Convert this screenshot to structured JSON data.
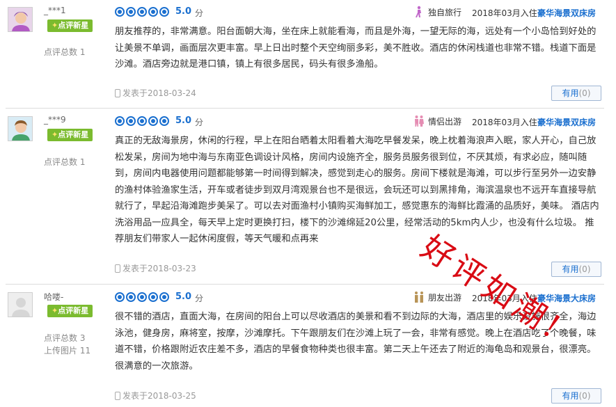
{
  "reviews": [
    {
      "username": "_***1",
      "badge": "点评新星",
      "review_count": "点评总数 1",
      "photo_count": "",
      "score": "5.0",
      "score_unit": "分",
      "trip_type": "独自旅行",
      "stay_date": "2018年03月入住",
      "room_type": "豪华海景双床房",
      "text": "朋友推荐的，非常满意。阳台面朝大海，坐在床上就能看海，而且是外海，一望无际的海，远处有一个小岛恰到好处的让美景不单调，画面层次更丰富。早上日出时整个天空绚丽多彩，美不胜收。酒店的休闲栈道也非常不错。栈道下面是沙滩。酒店旁边就是港口镇，镇上有很多居民，码头有很多渔船。",
      "posted": "发表于2018-03-24",
      "useful_label": "有用",
      "useful_count": "(0)",
      "avatar_icon": "avatar-purple-icon",
      "trip_icon": "solo-travel-icon"
    },
    {
      "username": "_***9",
      "badge": "点评新星",
      "review_count": "点评总数 1",
      "photo_count": "",
      "score": "5.0",
      "score_unit": "分",
      "trip_type": "情侣出游",
      "stay_date": "2018年03月入住",
      "room_type": "豪华海景双床房",
      "text": "真正的无敌海景房，休闲的行程，早上在阳台晒着太阳看着大海吃早餐发呆，晚上枕着海浪声入眠，家人开心，自己放松发呆，房间为地中海与东南亚色调设计风格，房间内设施齐全，服务员服务很到位，不厌其烦，有求必应，随叫随到，房间内电器使用问题都能够第一时间得到解决，感觉到走心的服务。房间下楼就是海滩，可以步行至另外一边安静的渔村体验渔家生活，开车或者徒步到双月湾观景台也不是很远，会玩还可以到黑排角，海滨温泉也不远开车直接导航就行了，早起沿海滩跑步美呆了。可以去对面渔村小镇购买海鲜加工，感觉惠东的海鲜比霞涌的品质好，美味。 酒店内洗浴用品一应具全，每天早上定时更换打扫，楼下的沙滩绵延20公里，经常活动的5km内人少，也没有什么垃圾。 推荐朋友们带家人一起休闲度假，等天气暖和点再来",
      "posted": "发表于2018-03-23",
      "useful_label": "有用",
      "useful_count": "(0)",
      "avatar_icon": "avatar-man-icon",
      "trip_icon": "couple-travel-icon"
    },
    {
      "username": "哈喽-",
      "badge": "点评新星",
      "review_count": "点评总数 3",
      "photo_count": "上传图片 11",
      "score": "5.0",
      "score_unit": "分",
      "trip_type": "朋友出游",
      "stay_date": "2018年03月入住",
      "room_type": "豪华海景大床房",
      "text": "很不错的酒店，直面大海，在房间的阳台上可以尽收酒店的美景和看不到边际的大海，酒店里的娱乐设施很齐全，海边泳池，健身房，麻将室，按摩，沙滩摩托。下午跟朋友们在沙滩上玩了一会，非常有感觉。晚上在酒店吃了个晚餐，味道不错，价格跟附近农庄差不多，酒店的早餐食物种类也很丰富。第二天上午还去了附近的海龟岛和观景台，很漂亮。很满意的一次旅游。",
      "posted": "发表于2018-03-25",
      "useful_label": "有用",
      "useful_count": "(0)",
      "avatar_icon": "avatar-default-icon",
      "trip_icon": "friends-travel-icon"
    }
  ],
  "stamp_text": "好评如潮!",
  "colors": {
    "accent": "#1a6fcf",
    "badge": "#7bbb2f",
    "stamp": "#d90b14"
  }
}
